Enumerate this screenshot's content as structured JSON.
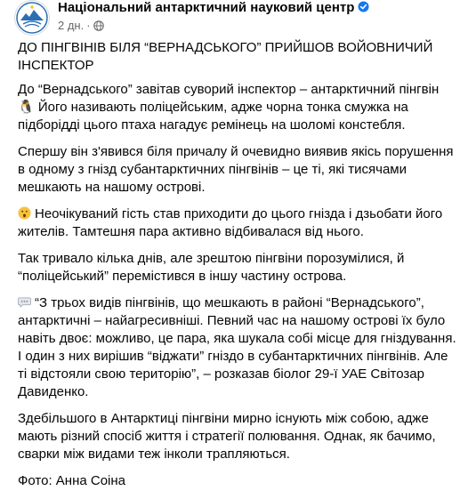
{
  "post": {
    "page_name": "Національний антарктичний науковий центр",
    "time": "2 дн.",
    "dot": "·",
    "title": "ДО ПІНГВІНІВ БІЛЯ “ВЕРНАДСЬКОГО” ПРИЙШОВ ВОЙОВНИЧИЙ ІНСПЕКТОР",
    "paragraphs": [
      "До “Вернадського” завітав суворий інспектор – антарктичний пінгвін 🐧 Його називають поліцейським, адже чорна тонка смужка на підборідді цього птаха нагадує ремінець на шоломі констебля.",
      "Спершу він з'явився біля причалу й очевидно виявив якісь порушення в одному з гнізд субантарктичних пінгвінів – це ті, які тисячами мешкають на нашому острові.",
      "Неочікуваний гість став приходити до цього гнізда і дзьобати його жителів. Тамтешня пара активно відбивалася від нього.",
      "Так тривало кілька днів, але зрештою пінгвіни порозумілися, й “поліцейський” перемістився в іншу частину острова.",
      "“З трьох видів пінгвінів, що мешкають в районі “Вернадського”, антарктичні – найагресивніші. Певний час на нашому острові їх було навіть двоє: можливо, це пара, яка шукала собі місце для гніздування. І один з них вирішив “віджати” гніздо в субантарктичних пінгвінів. Але ті відстояли свою територію”, – розказав біолог 29-ї УАЕ Світозар Давиденко.",
      "Здебільшого в Антарктиці пінгвіни мирно існують між собою, адже мають різний спосіб життя і стратегії полювання. Однак, як бачимо, сварки між видами теж інколи трапляються.",
      "Фото: Анна Соіна"
    ]
  },
  "icons": {
    "verified": "verified-badge-icon",
    "privacy": "globe-icon",
    "surprised": "surprised-face-emoji",
    "speech": "speech-bubble-emoji"
  },
  "colors": {
    "text": "#050505",
    "secondary": "#65676b",
    "verified": "#1877f2",
    "logo": "#2a6fb3"
  }
}
